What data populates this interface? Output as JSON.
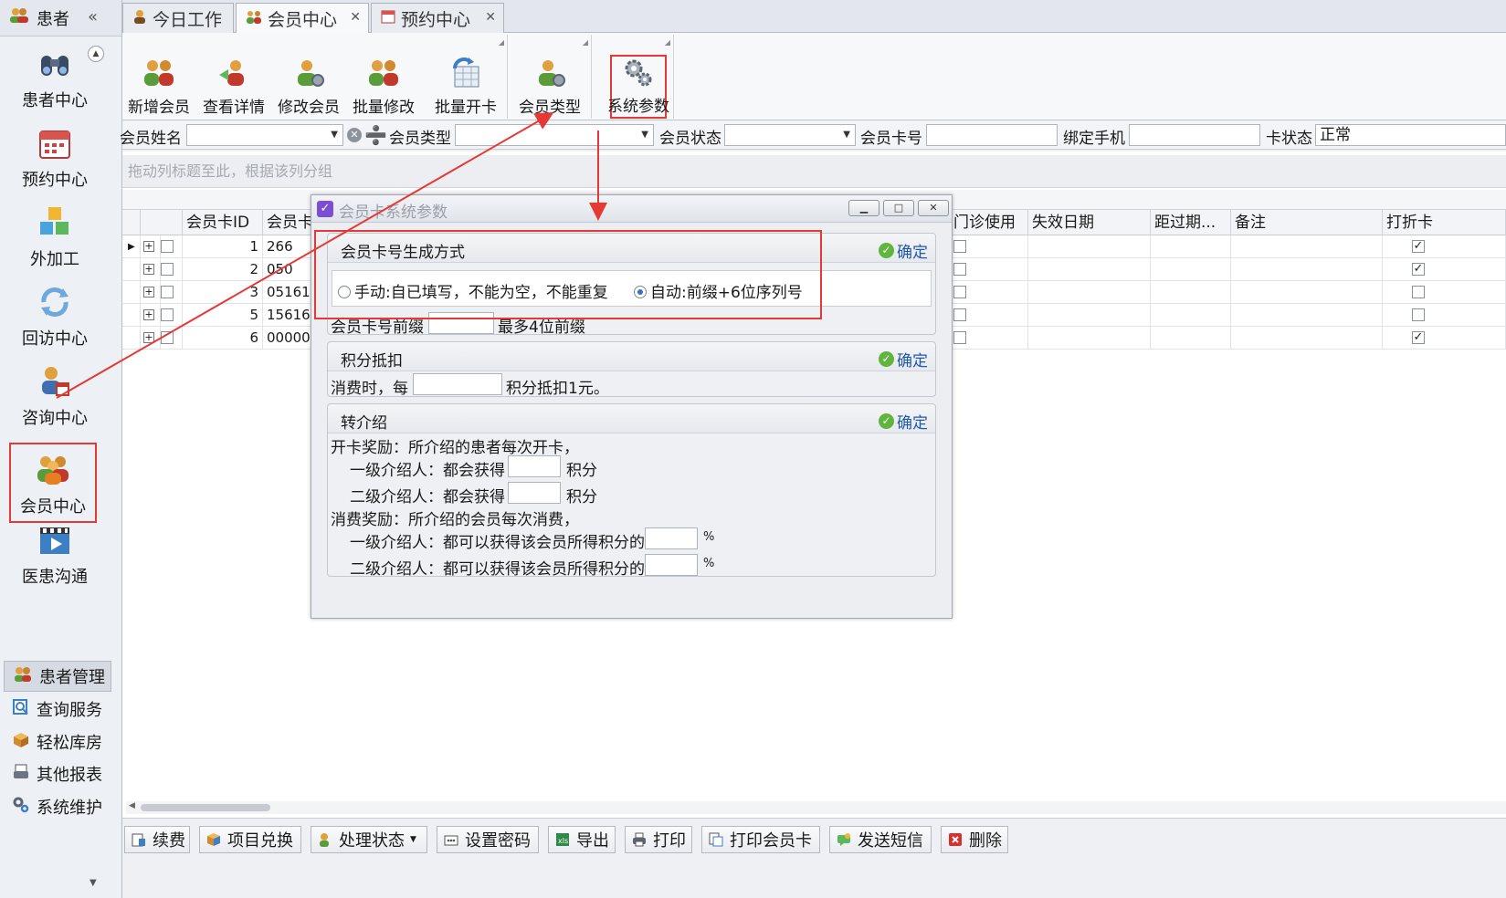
{
  "sidebar": {
    "header": "患者",
    "collapse": "«",
    "nav": [
      {
        "label": "患者中心",
        "icon": "binoculars-icon"
      },
      {
        "label": "预约中心",
        "icon": "calendar-icon"
      },
      {
        "label": "外加工",
        "icon": "cubes-icon"
      },
      {
        "label": "回访中心",
        "icon": "refresh-icon"
      },
      {
        "label": "咨询中心",
        "icon": "consult-icon"
      },
      {
        "label": "会员中心",
        "icon": "members-icon"
      },
      {
        "label": "医患沟通",
        "icon": "video-icon"
      }
    ],
    "bottom": [
      {
        "label": "患者管理",
        "icon": "patients-icon"
      },
      {
        "label": "查询服务",
        "icon": "query-icon"
      },
      {
        "label": "轻松库房",
        "icon": "warehouse-icon"
      },
      {
        "label": "其他报表",
        "icon": "report-icon"
      },
      {
        "label": "系统维护",
        "icon": "maintenance-icon"
      }
    ]
  },
  "tabs": [
    {
      "label": "今日工作",
      "icon": "today-icon"
    },
    {
      "label": "会员中心",
      "icon": "members-icon"
    },
    {
      "label": "预约中心",
      "icon": "calendar-icon"
    }
  ],
  "ribbon": {
    "buttons": [
      "新增会员",
      "查看详情",
      "修改会员",
      "批量修改",
      "批量开卡",
      "会员类型",
      "系统参数"
    ]
  },
  "filter": {
    "name_label": "会员姓名",
    "type_label": "会员类型",
    "status_label": "会员状态",
    "card_label": "会员卡号",
    "phone_label": "绑定手机",
    "card_status_label": "卡状态",
    "card_status_value": "正常"
  },
  "grid": {
    "group_hint": "拖动列标题至此，根据该列分组",
    "columns": [
      "会员卡ID",
      "会员卡",
      "门诊使用",
      "失效日期",
      "距过期...",
      "备注",
      "打折卡"
    ],
    "rows": [
      {
        "id": "1",
        "card": "266",
        "clinic": false,
        "discount": true
      },
      {
        "id": "2",
        "card": "050",
        "clinic": false,
        "discount": true
      },
      {
        "id": "3",
        "card": "05161",
        "clinic": false,
        "discount": false
      },
      {
        "id": "5",
        "card": "156161",
        "clinic": false,
        "discount": false
      },
      {
        "id": "6",
        "card": "000001",
        "clinic": false,
        "discount": true
      }
    ]
  },
  "toolbar": {
    "buttons": [
      "续费",
      "项目兑换",
      "处理状态",
      "设置密码",
      "导出",
      "打印",
      "打印会员卡",
      "发送短信",
      "删除"
    ]
  },
  "dialog": {
    "title": "会员卡系统参数",
    "ok": "确定",
    "section1": {
      "title": "会员卡号生成方式",
      "manual": "手动:自已填写，不能为空，不能重复",
      "auto": "自动:前缀+6位序列号",
      "prefix_label": "会员卡号前缀",
      "prefix_hint": "最多4位前缀"
    },
    "section2": {
      "title": "积分抵扣",
      "before": "消费时，每",
      "after": "积分抵扣1元。"
    },
    "section3": {
      "title": "转介绍",
      "open_reward": "开卡奖励：所介绍的患者每次开卡，",
      "level1": "一级介绍人：都会获得",
      "level2": "二级介绍人：都会获得",
      "points": "积分",
      "consume_reward": "消费奖励：所介绍的会员每次消费，",
      "level1_pct": "一级介绍人：都可以获得该会员所得积分的",
      "level2_pct": "二级介绍人：都可以获得该会员所得积分的",
      "pct": "%"
    }
  }
}
